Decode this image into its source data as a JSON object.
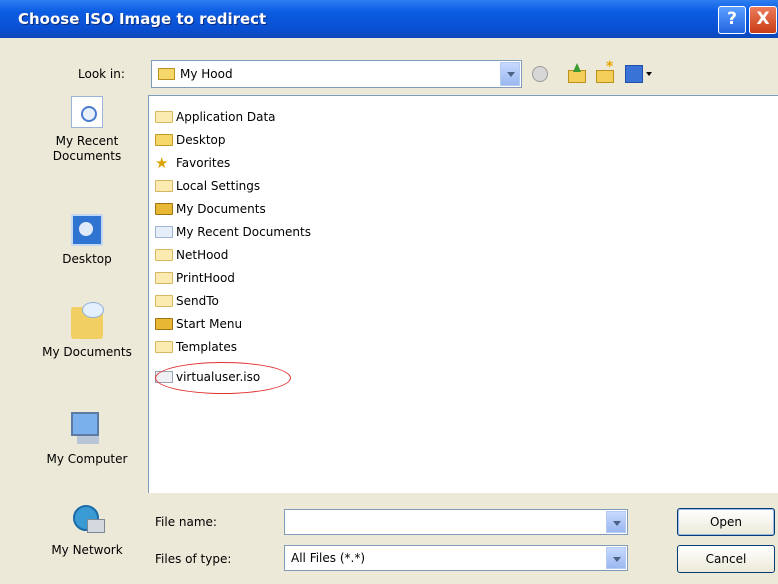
{
  "window": {
    "title": "Choose ISO Image to redirect",
    "help_label": "?",
    "close_label": "X"
  },
  "toolbar": {
    "look_in_label": "Look in:",
    "look_in_value": "My Hood"
  },
  "places": [
    {
      "label_line1": "My Recent",
      "label_line2": "Documents",
      "icon": "recent-documents-icon"
    },
    {
      "label_line1": "Desktop",
      "label_line2": "",
      "icon": "desktop-icon"
    },
    {
      "label_line1": "My Documents",
      "label_line2": "",
      "icon": "my-documents-icon"
    },
    {
      "label_line1": "My Computer",
      "label_line2": "",
      "icon": "my-computer-icon"
    },
    {
      "label_line1": "My Network",
      "label_line2": "",
      "icon": "my-network-icon"
    }
  ],
  "files": [
    {
      "name": "Application Data",
      "icon": "folder-icon"
    },
    {
      "name": "Desktop",
      "icon": "folder-icon"
    },
    {
      "name": "Favorites",
      "icon": "favorites-icon"
    },
    {
      "name": "Local Settings",
      "icon": "folder-icon"
    },
    {
      "name": "My Documents",
      "icon": "folder-icon"
    },
    {
      "name": "My Recent Documents",
      "icon": "recent-documents-icon"
    },
    {
      "name": "NetHood",
      "icon": "folder-icon"
    },
    {
      "name": "PrintHood",
      "icon": "folder-icon"
    },
    {
      "name": "SendTo",
      "icon": "folder-icon"
    },
    {
      "name": "Start Menu",
      "icon": "folder-icon"
    },
    {
      "name": "Templates",
      "icon": "folder-icon"
    },
    {
      "name": "virtualuser.iso",
      "icon": "iso-file-icon",
      "highlighted": true
    }
  ],
  "form": {
    "file_name_label": "File name:",
    "file_name_value": "",
    "file_type_label": "Files of type:",
    "file_type_value": "All Files (*.*)",
    "open_label": "Open",
    "cancel_label": "Cancel"
  },
  "colors": {
    "title_bar": "#0c5de3",
    "highlight_ring": "#e03030",
    "dialog_bg": "#ece9d8"
  }
}
